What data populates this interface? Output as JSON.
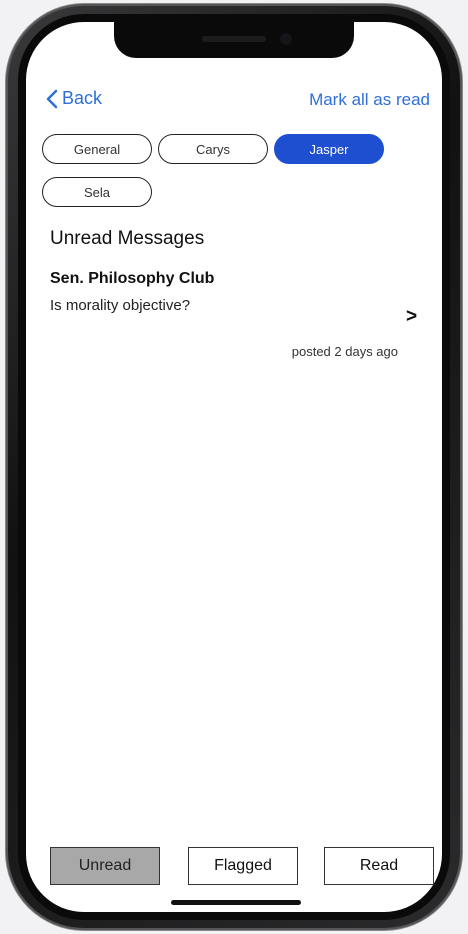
{
  "nav": {
    "back_label": "Back",
    "mark_all_label": "Mark all as read"
  },
  "filters": [
    {
      "label": "General",
      "active": false
    },
    {
      "label": "Carys",
      "active": false
    },
    {
      "label": "Jasper",
      "active": true
    },
    {
      "label": "Sela",
      "active": false
    }
  ],
  "section": {
    "title": "Unread Messages"
  },
  "messages": [
    {
      "group": "Sen. Philosophy Club",
      "subject": "Is morality objective?",
      "chevron": ">",
      "time": "posted 2 days ago"
    }
  ],
  "tabs": [
    {
      "label": "Unread",
      "active": true
    },
    {
      "label": "Flagged",
      "active": false
    },
    {
      "label": "Read",
      "active": false
    }
  ],
  "colors": {
    "accent": "#2f6fd6",
    "active_pill": "#1f4fd1",
    "active_tab": "#a8a8a8"
  },
  "icons": {
    "back": "chevron-left-icon"
  }
}
